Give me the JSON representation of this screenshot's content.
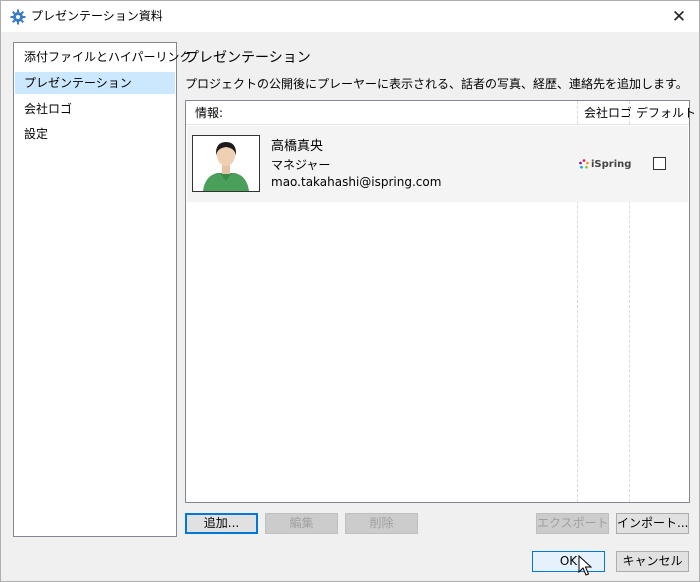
{
  "window": {
    "title": "プレゼンテーション資料",
    "close_glyph": "✕"
  },
  "sidebar": {
    "items": [
      {
        "label": "添付ファイルとハイパーリンク",
        "selected": false
      },
      {
        "label": "プレゼンテーション",
        "selected": true
      },
      {
        "label": "会社ロゴ",
        "selected": false
      },
      {
        "label": "設定",
        "selected": false
      }
    ]
  },
  "main": {
    "title": "プレゼンテーション",
    "description": "プロジェクトの公開後にプレーヤーに表示される、話者の写真、経歴、連絡先を追加します。",
    "table": {
      "columns": [
        "情報:",
        "会社ロゴ",
        "デフォルト"
      ],
      "rows": [
        {
          "name": "高橋真央",
          "role": "マネジャー",
          "email": "mao.takahashi@ispring.com",
          "logo_text": "iSpring",
          "default": false
        }
      ]
    },
    "buttons": {
      "add": "追加...",
      "edit": "編集",
      "delete": "削除",
      "export": "エクスポート",
      "import": "インポート..."
    }
  },
  "footer": {
    "ok": "OK",
    "cancel": "キャンセル"
  },
  "colors": {
    "accent": "#0078d7",
    "selection": "#cce8ff"
  }
}
